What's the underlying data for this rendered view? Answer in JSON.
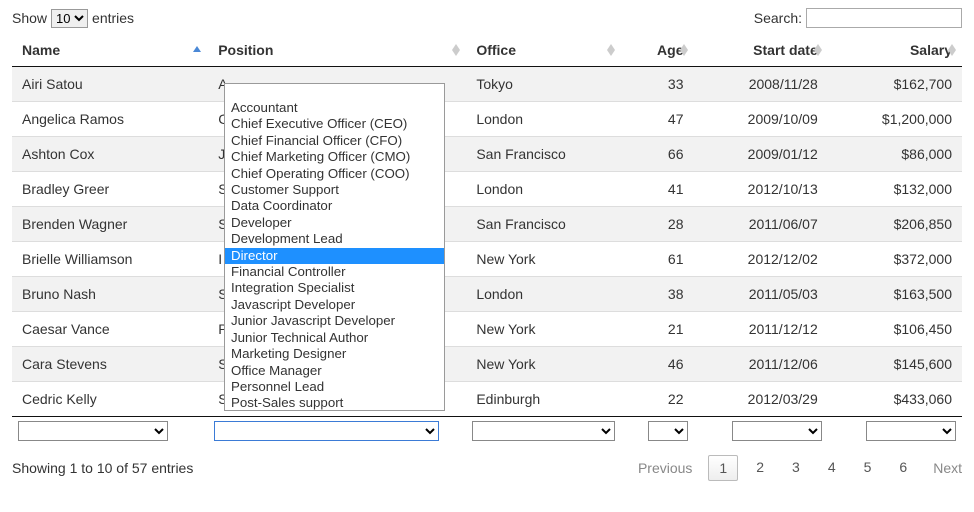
{
  "length_menu": {
    "show_label": "Show",
    "entries_label": "entries",
    "value": "10"
  },
  "search": {
    "label": "Search:",
    "value": ""
  },
  "columns": {
    "name": "Name",
    "position": "Position",
    "office": "Office",
    "age": "Age",
    "start_date": "Start date",
    "salary": "Salary"
  },
  "rows": [
    {
      "name": "Airi Satou",
      "position_initial": "A",
      "office": "Tokyo",
      "age": "33",
      "start_date": "2008/11/28",
      "salary": "$162,700"
    },
    {
      "name": "Angelica Ramos",
      "position_initial": "C",
      "office": "London",
      "age": "47",
      "start_date": "2009/10/09",
      "salary": "$1,200,000"
    },
    {
      "name": "Ashton Cox",
      "position_initial": "J",
      "office": "San Francisco",
      "age": "66",
      "start_date": "2009/01/12",
      "salary": "$86,000"
    },
    {
      "name": "Bradley Greer",
      "position_initial": "S",
      "office": "London",
      "age": "41",
      "start_date": "2012/10/13",
      "salary": "$132,000"
    },
    {
      "name": "Brenden Wagner",
      "position_initial": "S",
      "office": "San Francisco",
      "age": "28",
      "start_date": "2011/06/07",
      "salary": "$206,850"
    },
    {
      "name": "Brielle Williamson",
      "position_initial": "I",
      "office": "New York",
      "age": "61",
      "start_date": "2012/12/02",
      "salary": "$372,000"
    },
    {
      "name": "Bruno Nash",
      "position_initial": "S",
      "office": "London",
      "age": "38",
      "start_date": "2011/05/03",
      "salary": "$163,500"
    },
    {
      "name": "Caesar Vance",
      "position_initial": "P",
      "office": "New York",
      "age": "21",
      "start_date": "2011/12/12",
      "salary": "$106,450"
    },
    {
      "name": "Cara Stevens",
      "position_initial": "S",
      "office": "New York",
      "age": "46",
      "start_date": "2011/12/06",
      "salary": "$145,600"
    },
    {
      "name": "Cedric Kelly",
      "position_initial": "S",
      "office": "Edinburgh",
      "age": "22",
      "start_date": "2012/03/29",
      "salary": "$433,060"
    }
  ],
  "position_dropdown": {
    "selected": "Director",
    "options": [
      "",
      "Accountant",
      "Chief Executive Officer (CEO)",
      "Chief Financial Officer (CFO)",
      "Chief Marketing Officer (CMO)",
      "Chief Operating Officer (COO)",
      "Customer Support",
      "Data Coordinator",
      "Developer",
      "Development Lead",
      "Director",
      "Financial Controller",
      "Integration Specialist",
      "Javascript Developer",
      "Junior Javascript Developer",
      "Junior Technical Author",
      "Marketing Designer",
      "Office Manager",
      "Personnel Lead",
      "Post-Sales support"
    ]
  },
  "info_text": "Showing 1 to 10 of 57 entries",
  "pagination": {
    "previous": "Previous",
    "next": "Next",
    "pages": [
      "1",
      "2",
      "3",
      "4",
      "5",
      "6"
    ],
    "current": "1"
  }
}
